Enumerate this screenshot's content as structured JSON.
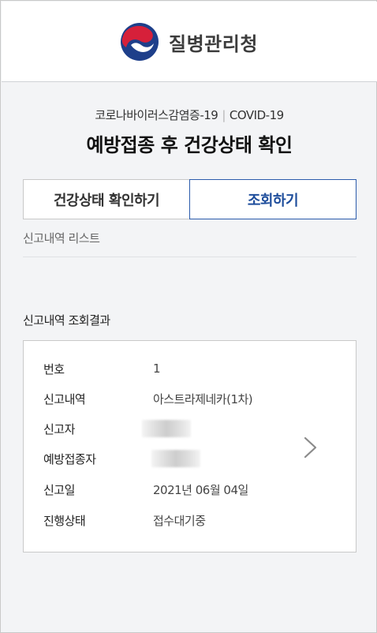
{
  "header": {
    "org_name": "질병관리청"
  },
  "intro": {
    "subtitle_ko": "코로나바이러스감염증-19",
    "subtitle_separator": "|",
    "subtitle_en": "COVID-19",
    "title": "예방접종 후 건강상태 확인"
  },
  "tabs": [
    {
      "label": "건강상태 확인하기",
      "active": false
    },
    {
      "label": "조회하기",
      "active": true
    }
  ],
  "list_label": "신고내역 리스트",
  "result": {
    "section_title": "신고내역 조회결과",
    "rows": [
      {
        "key": "번호",
        "value": "1"
      },
      {
        "key": "신고내역",
        "value": "아스트라제네카(1차)"
      },
      {
        "key": "신고자",
        "value": ""
      },
      {
        "key": "예방접종자",
        "value": ""
      },
      {
        "key": "신고일",
        "value": "2021년 06월 04일"
      },
      {
        "key": "진행상태",
        "value": "접수대기중"
      }
    ]
  },
  "icons": {
    "logo": "taegeuk-logo-icon",
    "card_arrow": "chevron-right-icon"
  },
  "colors": {
    "accent_blue": "#1f4e9c",
    "logo_red": "#d6203a",
    "logo_blue": "#1e3f8a",
    "background": "#f3f4f6"
  }
}
